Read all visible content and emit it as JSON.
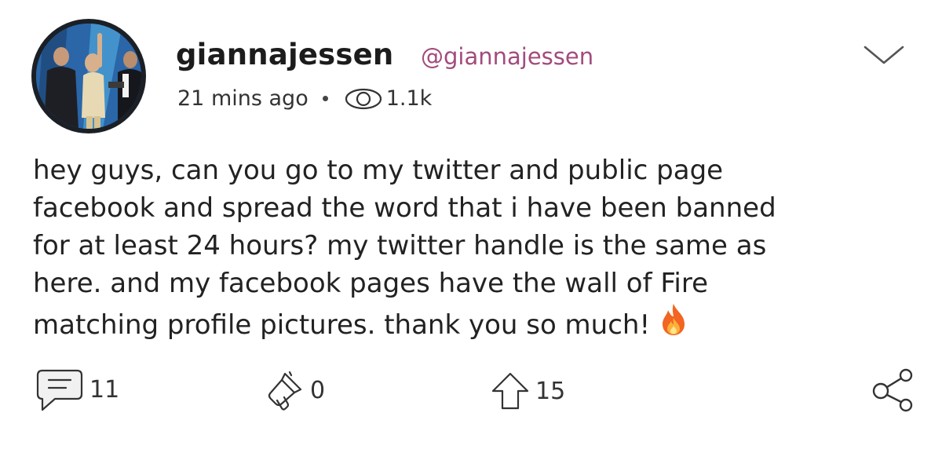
{
  "post": {
    "username": "giannajessen",
    "handle": "@giannajessen",
    "time_ago": "21 mins ago",
    "views": "1.1k",
    "body_lines": [
      "hey guys, can you go to my twitter and public page",
      "facebook and spread the word that i have been banned",
      "for at least 24 hours? my twitter handle is the same as",
      "here. and my facebook pages have the wall of Fire",
      "matching profile pictures. thank you so much!"
    ],
    "emoji": "fire-emoji"
  },
  "actions": {
    "comments": "11",
    "boosts": "0",
    "upvotes": "15"
  },
  "icons": {
    "menu": "chevron-down-icon",
    "views": "eye-icon",
    "comment": "comment-icon",
    "boost": "megaphone-icon",
    "upvote": "arrow-up-icon",
    "share": "share-icon"
  },
  "colors": {
    "handle": "#a24b7d",
    "text": "#222222",
    "icon": "#333333",
    "background": "#ffffff"
  }
}
